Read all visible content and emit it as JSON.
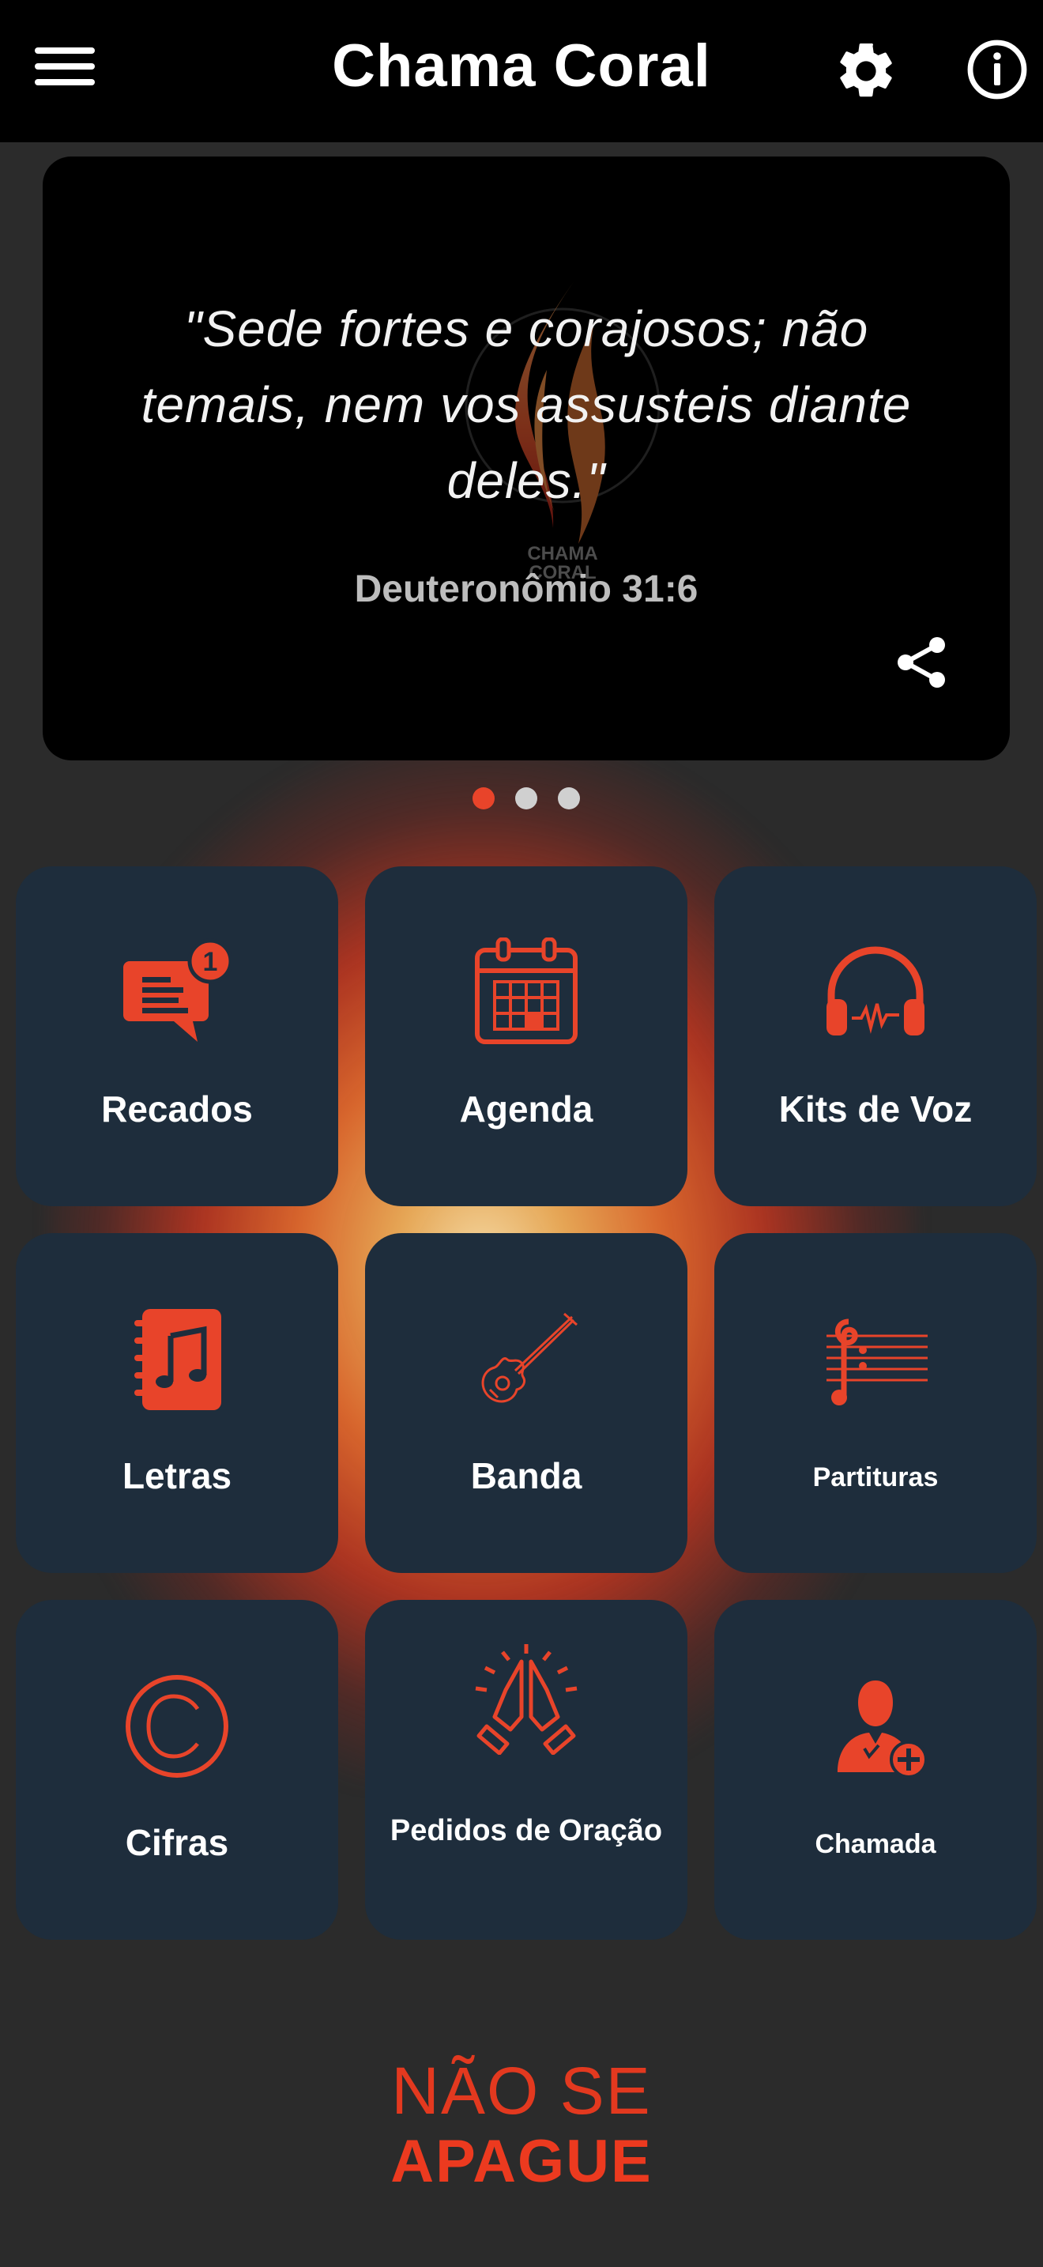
{
  "header": {
    "title": "Chama Coral",
    "menu_icon": "hamburger-menu-icon",
    "settings_icon": "gear-icon",
    "info_icon": "info-icon"
  },
  "carousel": {
    "verse": "\"Sede fortes e corajosos; não temais, nem vos assusteis diante deles.\"",
    "reference": "Deuteronômio 31:6",
    "logo_text": "CHAMA CORAL",
    "slide_count": 3,
    "active_slide": 1,
    "share_icon": "share-icon"
  },
  "grid": {
    "items": [
      {
        "label": "Recados",
        "icon": "message-icon",
        "badge": "1"
      },
      {
        "label": "Agenda",
        "icon": "calendar-icon"
      },
      {
        "label": "Kits de Voz",
        "icon": "headphones-icon"
      },
      {
        "label": "Letras",
        "icon": "music-book-icon"
      },
      {
        "label": "Banda",
        "icon": "guitar-icon"
      },
      {
        "label": "Partituras",
        "icon": "sheet-music-icon"
      },
      {
        "label": "Cifras",
        "icon": "copyright-icon"
      },
      {
        "label": "Pedidos de Oração",
        "icon": "praying-hands-icon"
      },
      {
        "label": "Chamada",
        "icon": "add-user-icon"
      }
    ]
  },
  "footer": {
    "line1": "NÃO SE",
    "line2": "APAGUE"
  },
  "colors": {
    "accent": "#e8442a",
    "tile_bg": "#1e2d3c",
    "header_bg": "#000000",
    "page_bg": "#2b2b2b"
  }
}
